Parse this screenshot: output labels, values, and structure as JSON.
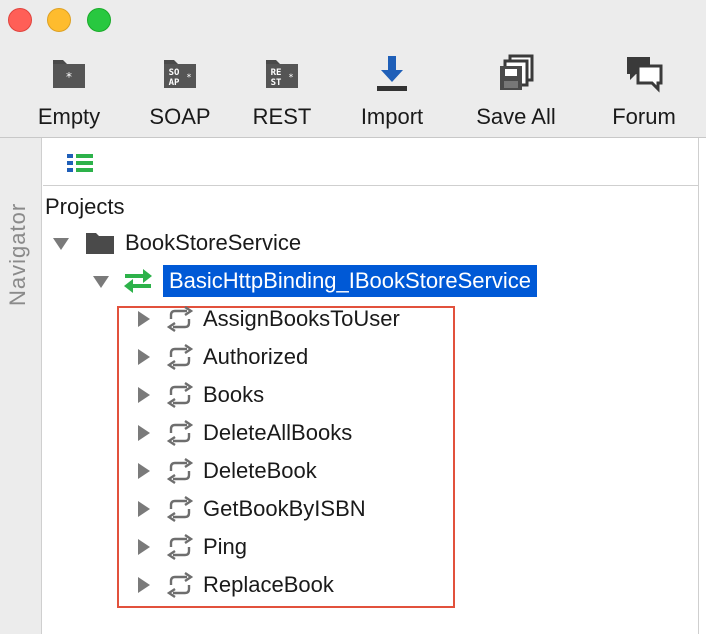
{
  "toolbar": {
    "items": [
      {
        "label": "Empty",
        "icon": "empty-project-icon"
      },
      {
        "label": "SOAP",
        "icon": "soap-icon",
        "glyph": "SO\nAP"
      },
      {
        "label": "REST",
        "icon": "rest-icon",
        "glyph": "RE\nST"
      },
      {
        "label": "Import",
        "icon": "import-icon"
      },
      {
        "label": "Save All",
        "icon": "save-all-icon"
      },
      {
        "label": "Forum",
        "icon": "forum-icon"
      }
    ]
  },
  "navigator": {
    "label": "Navigator"
  },
  "tree": {
    "root_label": "Projects",
    "project": {
      "name": "BookStoreService",
      "expanded": true
    },
    "binding": {
      "name": "BasicHttpBinding_IBookStoreService",
      "expanded": true,
      "selected": true
    },
    "operations": [
      "AssignBooksToUser",
      "Authorized",
      "Books",
      "DeleteAllBooks",
      "DeleteBook",
      "GetBookByISBN",
      "Ping",
      "ReplaceBook"
    ]
  },
  "colors": {
    "selection": "#0059d6",
    "highlight_box": "#e2513c",
    "binding_icon": "#2db24a",
    "import_icon": "#1f5fb8"
  }
}
